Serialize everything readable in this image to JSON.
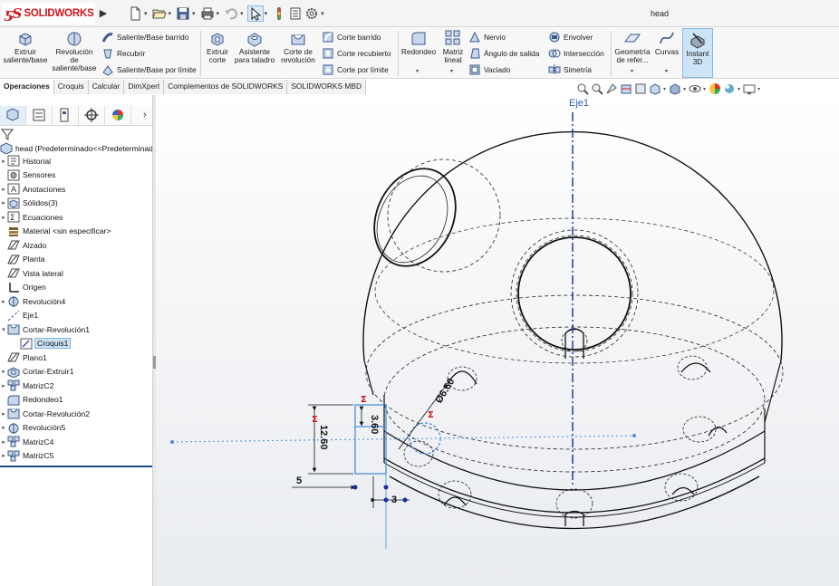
{
  "app": {
    "logo_text": "SOLIDWORKS",
    "document_title": "head"
  },
  "colors": {
    "brand_red": "#d4121a",
    "selection_blue": "#cde4f7",
    "axis_blue": "#2f5fb3",
    "dimension_red": "#d4121a"
  },
  "quick_access": [
    "new-document-icon",
    "open-icon",
    "save-icon",
    "print-icon",
    "undo-icon",
    "select-arrow-icon",
    "rebuild-icon",
    "file-properties-icon",
    "options-gear-icon"
  ],
  "ribbon": {
    "extrude_boss": "Extruir saliente/base",
    "revolve_boss": "Revolución de saliente/base",
    "swept_boss": "Saliente/Base barrido",
    "loft_boss": "Recubrir",
    "boundary_boss": "Saliente/Base por límite",
    "extrude_cut": "Extruir corte",
    "hole_wizard": "Asistente para taladro",
    "revolve_cut": "Corte de revolución",
    "swept_cut": "Corte barrido",
    "lofted_cut": "Corte recubierto",
    "boundary_cut": "Corte por límite",
    "fillet": "Redondeo",
    "linear_pattern": "Matriz lineal",
    "rib": "Nervio",
    "draft": "Ángulo de salida",
    "shell": "Vaciado",
    "wrap": "Envolver",
    "intersect": "Intersección",
    "mirror": "Simetría",
    "ref_geometry": "Geometría de refer...",
    "curves": "Curvas",
    "instant3d": "Instant 3D"
  },
  "tabs": [
    "Operaciones",
    "Croquis",
    "Calcular",
    "DimXpert",
    "Complementos de SOLIDWORKS",
    "SOLIDWORKS MBD"
  ],
  "tree": {
    "root": "head  (Predeterminado<<Predeterminado",
    "items": [
      {
        "label": "Historial",
        "icon": "history-icon",
        "toggle": "▸"
      },
      {
        "label": "Sensores",
        "icon": "sensors-icon",
        "toggle": ""
      },
      {
        "label": "Anotaciones",
        "icon": "annotations-icon",
        "toggle": "▸"
      },
      {
        "label": "Sólidos(3)",
        "icon": "solid-bodies-icon",
        "toggle": "▸"
      },
      {
        "label": "Ecuaciones",
        "icon": "equations-icon",
        "toggle": "▸"
      },
      {
        "label": "Material <sin especificar>",
        "icon": "material-icon",
        "toggle": ""
      },
      {
        "label": "Alzado",
        "icon": "plane-icon",
        "toggle": ""
      },
      {
        "label": "Planta",
        "icon": "plane-icon",
        "toggle": ""
      },
      {
        "label": "Vista lateral",
        "icon": "plane-icon",
        "toggle": ""
      },
      {
        "label": "Origen",
        "icon": "origin-icon",
        "toggle": ""
      },
      {
        "label": "Revolución4",
        "icon": "revolve-icon",
        "toggle": "▸"
      },
      {
        "label": "Eje1",
        "icon": "axis-icon",
        "toggle": ""
      },
      {
        "label": "Cortar-Revolución1",
        "icon": "cut-revolve-icon",
        "toggle": "▾"
      },
      {
        "label": "Croquis1",
        "icon": "sketch-icon",
        "toggle": ""
      },
      {
        "label": "Plano1",
        "icon": "plane-icon",
        "toggle": ""
      },
      {
        "label": "Cortar-Extruir1",
        "icon": "cut-extrude-icon",
        "toggle": "▸"
      },
      {
        "label": "MatrizC2",
        "icon": "circular-pattern-icon",
        "toggle": "▸"
      },
      {
        "label": "Redondeo1",
        "icon": "fillet-icon",
        "toggle": ""
      },
      {
        "label": "Cortar-Revolución2",
        "icon": "cut-revolve-icon",
        "toggle": "▸"
      },
      {
        "label": "Revolución5",
        "icon": "revolve-icon",
        "toggle": "▸"
      },
      {
        "label": "MatrizC4",
        "icon": "circular-pattern-icon",
        "toggle": "▸"
      },
      {
        "label": "MatrizC5",
        "icon": "circular-pattern-icon",
        "toggle": "▸"
      }
    ]
  },
  "viewport": {
    "axis_label": "Eje1",
    "dimensions": {
      "d1": "3.60",
      "d2": "12.60",
      "d3": "Ø6.60",
      "d4": "5",
      "d5": "3"
    },
    "dimension_markers": [
      "Σ",
      "Σ",
      "Σ"
    ]
  }
}
